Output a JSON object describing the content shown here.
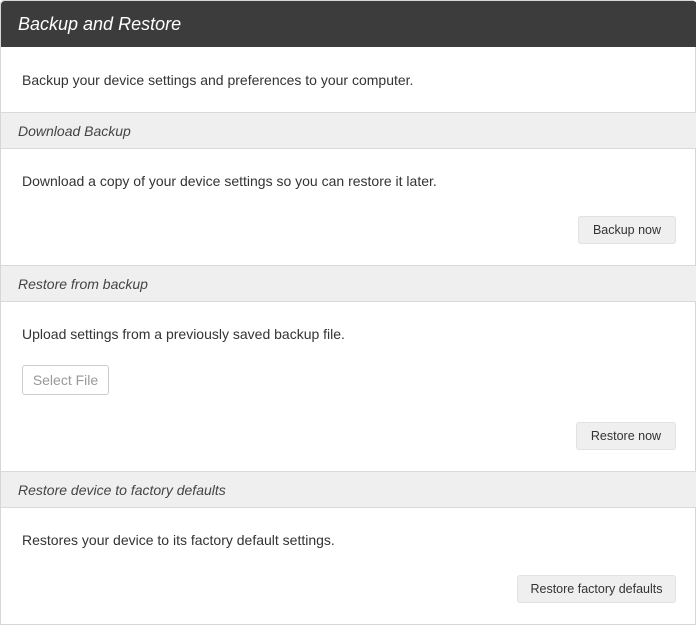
{
  "title": "Backup and Restore",
  "intro": "Backup your device settings and preferences to your computer.",
  "sections": [
    {
      "header": "Download Backup",
      "text": "Download a copy of your device settings so you can restore it later.",
      "button": "Backup now"
    },
    {
      "header": "Restore from backup",
      "text": "Upload settings from a previously saved backup file.",
      "file_button": "Select File",
      "button": "Restore now"
    },
    {
      "header": "Restore device to factory defaults",
      "text": "Restores your device to its factory default settings.",
      "button": "Restore factory defaults"
    }
  ]
}
